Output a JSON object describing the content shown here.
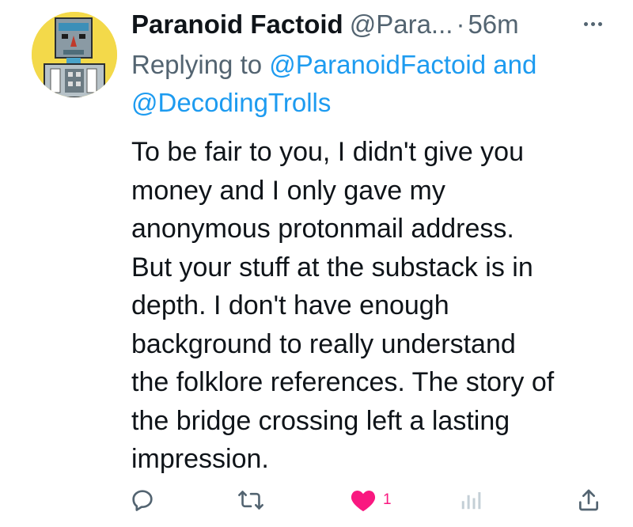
{
  "tweet": {
    "display_name": "Paranoid Factoid",
    "handle": "@Para...",
    "separator": "·",
    "time": "56m",
    "reply_prefix": "Replying to",
    "mention_1": "@ParanoidFactoid",
    "reply_joiner": "and",
    "mention_2": "@DecodingTrolls",
    "body_lines": [
      "To be fair to you, I didn't give you",
      "money and I only gave my",
      "anonymous protonmail address.",
      "But your stuff at the substack is in",
      "depth. I don't have enough",
      "background to really understand",
      "the folklore references. The story of",
      "the bridge crossing left a lasting",
      "impression."
    ]
  },
  "actions": {
    "reply_icon": "reply-icon",
    "retweet_icon": "retweet-icon",
    "like_icon": "heart-filled-icon",
    "like_count": "1",
    "views_icon": "views-bar-chart-icon",
    "share_icon": "share-icon"
  },
  "colors": {
    "text": "#0f1419",
    "secondary": "#536471",
    "link": "#1d9bf0",
    "like": "#f91880",
    "avatar_bg": "#f3d94a"
  }
}
